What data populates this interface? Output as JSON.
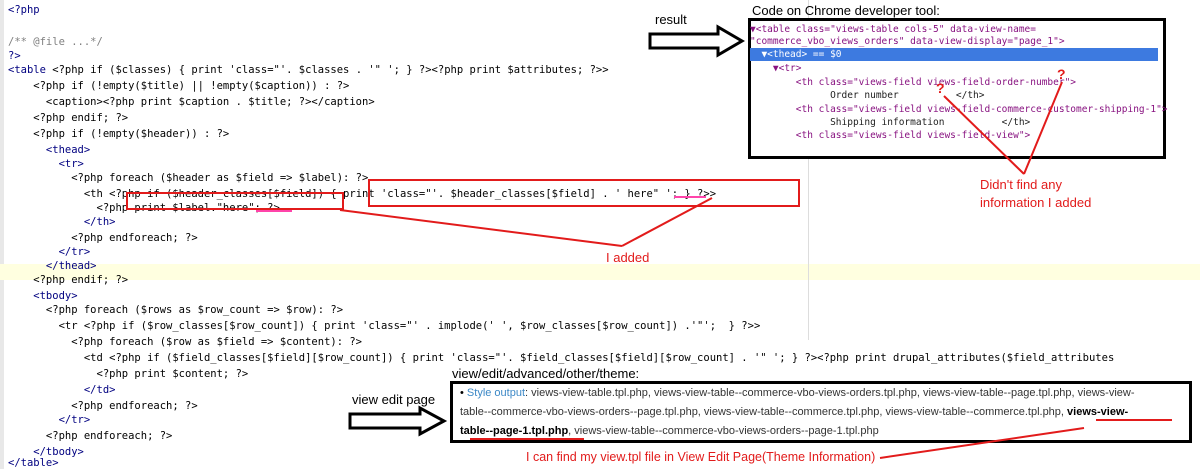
{
  "code": {
    "l1": "<?php",
    "l2": "/** @file ...*/",
    "l3": "?>",
    "l4a": "<table ",
    "l4b": "<?php if ($classes) { print 'class=\"'. $classes . '\" '; } ?><?php print $attributes; ?>>",
    "l5": "    <?php if (!empty($title) || !empty($caption)) : ?>",
    "l6": "      <caption><?php print $caption . $title; ?></caption>",
    "l7": "    <?php endif; ?>",
    "l8": "    <?php if (!empty($header)) : ?>",
    "l9": "      <thead>",
    "l10": "        <tr>",
    "l11": "          <?php foreach ($header as $field => $label): ?>",
    "l12a": "            <th <?php if ($header_classes[$field]) ",
    "l12b": "{ print 'class=\"'. $header_classes[$field] . ' here\" '; } ?>>",
    "l13": "              <?php print $label.\"here\"; ?>",
    "l14": "            </th>",
    "l15": "          <?php endforeach; ?>",
    "l16": "        </tr>",
    "l17": "      </thead>",
    "l18": "    <?php endif; ?>",
    "l19": "    <tbody>",
    "l20": "      <?php foreach ($rows as $row_count => $row): ?>",
    "l21": "        <tr <?php if ($row_classes[$row_count]) { print 'class=\"' . implode(' ', $row_classes[$row_count]) .'\"';  } ?>>",
    "l22": "          <?php foreach ($row as $field => $content): ?>",
    "l23": "            <td <?php if ($field_classes[$field][$row_count]) { print 'class=\"'. $field_classes[$field][$row_count] . '\" '; } ?><?php print drupal_attributes($field_attributes",
    "l24": "              <?php print $content; ?>",
    "l25": "            </td>",
    "l26": "          <?php endforeach; ?>",
    "l27": "        </tr>",
    "l28": "      <?php endforeach; ?>",
    "l29": "    </tbody>",
    "l30": "</table>"
  },
  "annotations": {
    "result": "result",
    "devtool_title": "Code on Chrome developer tool:",
    "not_found_1": "Didn't find any",
    "not_found_2": "information I added",
    "i_added": "I added",
    "theme_title": "view/edit/advanced/other/theme:",
    "view_edit_page": "view edit page",
    "found_file": "I can find my view.tpl file in View Edit Page(Theme Information)",
    "question_mark": "?"
  },
  "devtools": {
    "d1": "▼<table class=\"views-table cols-5\" data-view-name=",
    "d2": "\"commerce_vbo_views_orders\" data-view-display=\"page_1\">",
    "d3": "  ▼<thead> == $0",
    "d4": "    ▼<tr>",
    "d5": "        <th class=\"views-field views-field-order-number\">",
    "d6": "              Order number          </th>",
    "d7": "        <th class=\"views-field views-field-commerce-customer-shipping-1\">",
    "d8": "              Shipping information          </th>",
    "d9": "        <th class=\"views-field views-field-view\">"
  },
  "theme": {
    "label": "Style output",
    "files_1": ": views-view-table.tpl.php, views-view-table--commerce-vbo-views-orders.tpl.php, views-view-table--page.tpl.php, views-view-",
    "files_2": "table--commerce-vbo-views-orders--page.tpl.php, views-view-table--commerce.tpl.php, views-view-table--commerce.tpl.php, ",
    "files_2b": "views-view-",
    "files_3a": "table--page-1.tpl.php",
    "files_3b": ", views-view-table--commerce-vbo-views-orders--page-1.tpl.php"
  },
  "colors": {
    "annotation_red": "#e21b1b",
    "devtools_selection": "#3d7ae0"
  }
}
